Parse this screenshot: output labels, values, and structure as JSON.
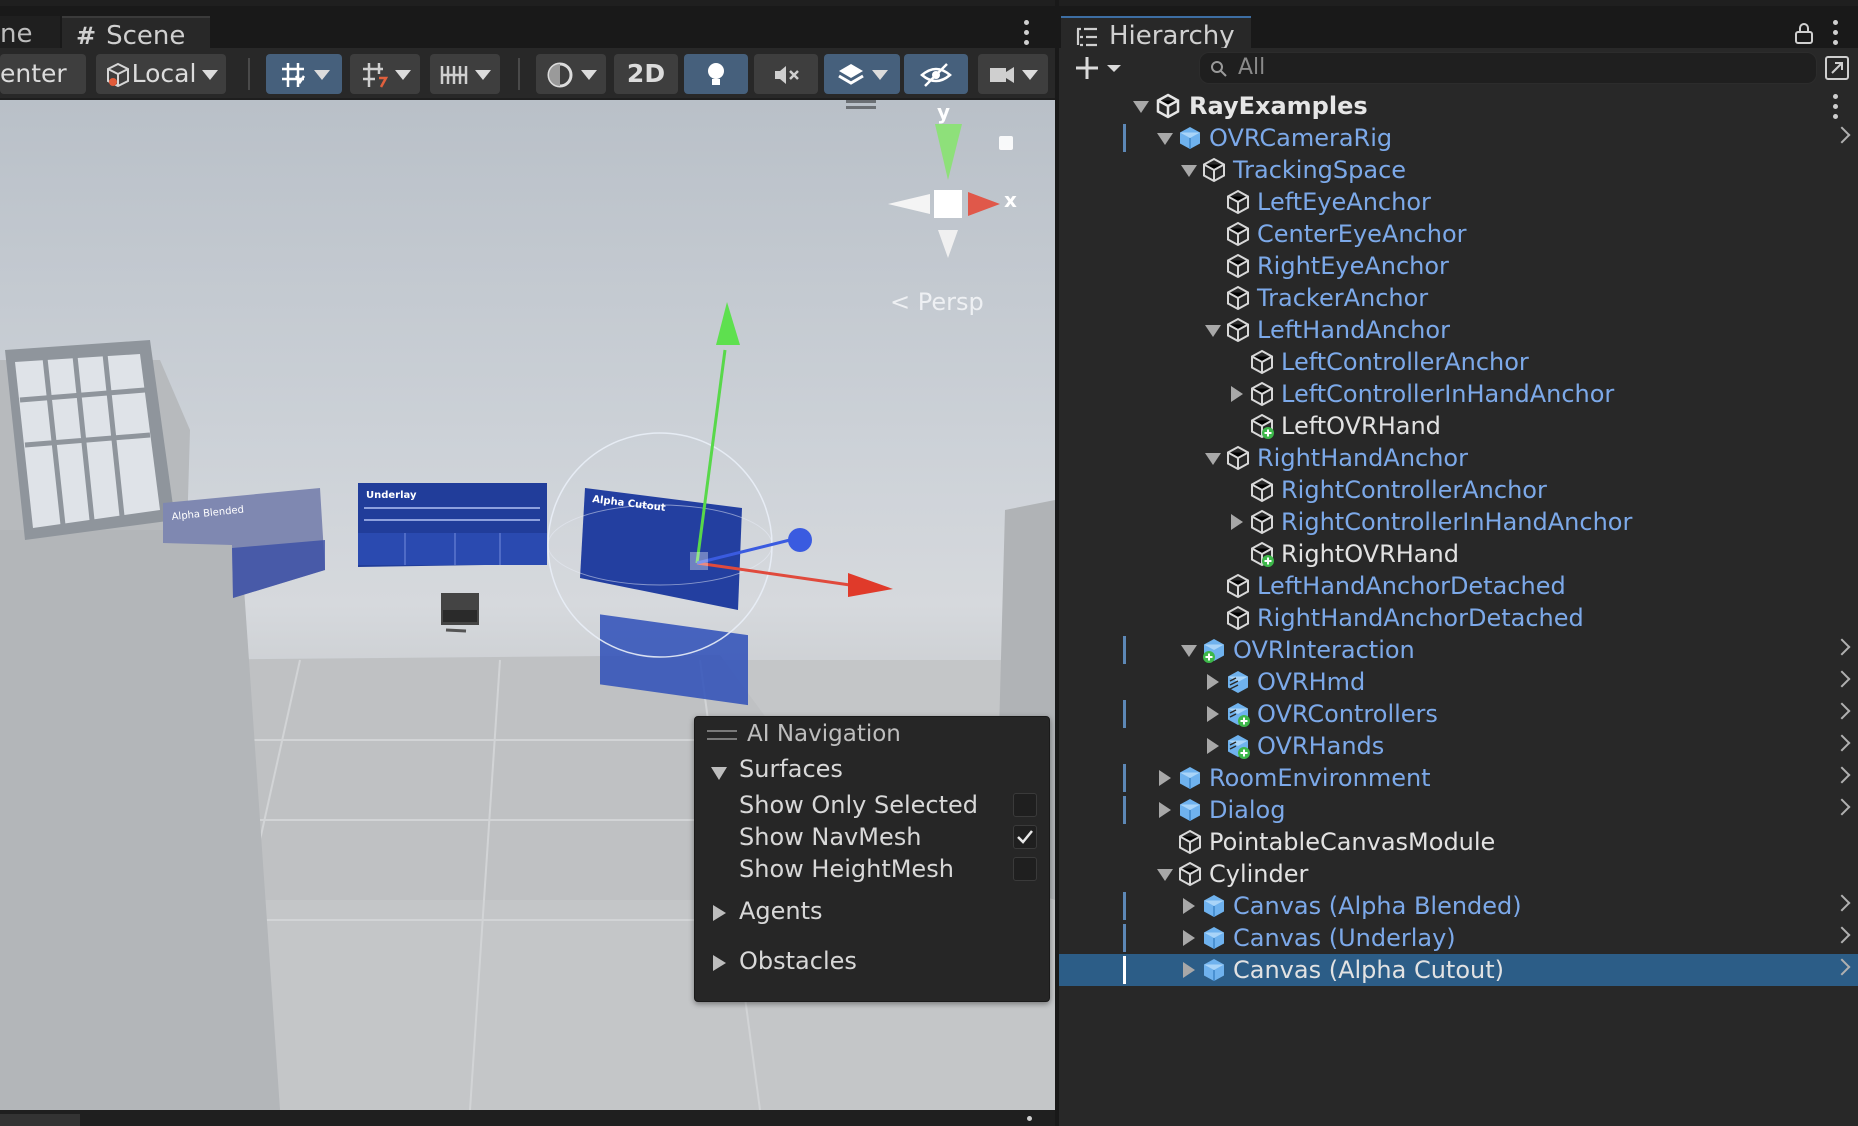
{
  "colors": {
    "accent": "#46607c",
    "selection": "#2c5d87",
    "prefab_text": "#7ca9e9",
    "panel_bg": "#282828"
  },
  "scene": {
    "prev_tab_label": "ne",
    "tab_label": "Scene",
    "toolbar": {
      "pivot_label": "enter",
      "space_label": "Local",
      "mode_2d_label": "2D"
    },
    "gizmo": {
      "y_label": "y",
      "x_label": "x",
      "persp_label": "Persp"
    },
    "panels_in_scene": [
      "Alpha Blended",
      "Underlay",
      "Alpha Cutout"
    ]
  },
  "ai_navigation": {
    "title": "AI Navigation",
    "surfaces_label": "Surfaces",
    "options": [
      {
        "label": "Show Only Selected",
        "checked": false
      },
      {
        "label": "Show NavMesh",
        "checked": true
      },
      {
        "label": "Show HeightMesh",
        "checked": false
      }
    ],
    "agents_label": "Agents",
    "obstacles_label": "Obstacles"
  },
  "hierarchy": {
    "tab_label": "Hierarchy",
    "search_placeholder": "All",
    "scene_name": "RayExamples",
    "items": [
      {
        "label": "OVRCameraRig",
        "depth": 1,
        "expand": "open",
        "icon": "prefab-cube-icon",
        "color": "blue",
        "bar": true,
        "chev": true
      },
      {
        "label": "TrackingSpace",
        "depth": 2,
        "expand": "open",
        "icon": "cube-outline-icon",
        "color": "blue"
      },
      {
        "label": "LeftEyeAnchor",
        "depth": 3,
        "expand": "none",
        "icon": "cube-outline-icon",
        "color": "blue"
      },
      {
        "label": "CenterEyeAnchor",
        "depth": 3,
        "expand": "none",
        "icon": "cube-outline-icon",
        "color": "blue"
      },
      {
        "label": "RightEyeAnchor",
        "depth": 3,
        "expand": "none",
        "icon": "cube-outline-icon",
        "color": "blue"
      },
      {
        "label": "TrackerAnchor",
        "depth": 3,
        "expand": "none",
        "icon": "cube-outline-icon",
        "color": "blue"
      },
      {
        "label": "LeftHandAnchor",
        "depth": 3,
        "expand": "open",
        "icon": "cube-outline-icon",
        "color": "blue"
      },
      {
        "label": "LeftControllerAnchor",
        "depth": 4,
        "expand": "none",
        "icon": "cube-outline-icon",
        "color": "blue"
      },
      {
        "label": "LeftControllerInHandAnchor",
        "depth": 4,
        "expand": "closed",
        "icon": "cube-outline-icon",
        "color": "blue"
      },
      {
        "label": "LeftOVRHand",
        "depth": 4,
        "expand": "none",
        "icon": "cube-added-icon",
        "color": "white"
      },
      {
        "label": "RightHandAnchor",
        "depth": 3,
        "expand": "open",
        "icon": "cube-outline-icon",
        "color": "blue"
      },
      {
        "label": "RightControllerAnchor",
        "depth": 4,
        "expand": "none",
        "icon": "cube-outline-icon",
        "color": "blue"
      },
      {
        "label": "RightControllerInHandAnchor",
        "depth": 4,
        "expand": "closed",
        "icon": "cube-outline-icon",
        "color": "blue"
      },
      {
        "label": "RightOVRHand",
        "depth": 4,
        "expand": "none",
        "icon": "cube-added-icon",
        "color": "white"
      },
      {
        "label": "LeftHandAnchorDetached",
        "depth": 3,
        "expand": "none",
        "icon": "cube-outline-icon",
        "color": "blue"
      },
      {
        "label": "RightHandAnchorDetached",
        "depth": 3,
        "expand": "none",
        "icon": "cube-outline-icon",
        "color": "blue"
      },
      {
        "label": "OVRInteraction",
        "depth": 2,
        "expand": "open",
        "icon": "prefab-added-icon",
        "color": "blue",
        "bar": true,
        "chev": true
      },
      {
        "label": "OVRHmd",
        "depth": 3,
        "expand": "closed",
        "icon": "prefab-variant-icon",
        "color": "blue",
        "chev": true
      },
      {
        "label": "OVRControllers",
        "depth": 3,
        "expand": "closed",
        "icon": "prefab-variant-added-icon",
        "color": "blue",
        "bar": true,
        "chev": true
      },
      {
        "label": "OVRHands",
        "depth": 3,
        "expand": "closed",
        "icon": "prefab-variant-added-icon",
        "color": "blue",
        "chev": true
      },
      {
        "label": "RoomEnvironment",
        "depth": 1,
        "expand": "closed",
        "icon": "prefab-cube-icon",
        "color": "blue",
        "bar": true,
        "chev": true
      },
      {
        "label": "Dialog",
        "depth": 1,
        "expand": "closed",
        "icon": "prefab-cube-icon",
        "color": "blue",
        "bar": true,
        "chev": true
      },
      {
        "label": "PointableCanvasModule",
        "depth": 1,
        "expand": "none",
        "icon": "cube-outline-icon",
        "color": "white"
      },
      {
        "label": "Cylinder",
        "depth": 1,
        "expand": "open",
        "icon": "cube-outline-icon",
        "color": "white"
      },
      {
        "label": "Canvas (Alpha Blended)",
        "depth": 2,
        "expand": "closed",
        "icon": "prefab-cube-icon",
        "color": "blue",
        "bar": true,
        "chev": true
      },
      {
        "label": "Canvas (Underlay)",
        "depth": 2,
        "expand": "closed",
        "icon": "prefab-cube-icon",
        "color": "blue",
        "bar": true,
        "chev": true
      },
      {
        "label": "Canvas (Alpha Cutout)",
        "depth": 2,
        "expand": "closed",
        "icon": "prefab-cube-icon",
        "color": "white",
        "bar": true,
        "chev": true,
        "selected": true
      }
    ]
  }
}
